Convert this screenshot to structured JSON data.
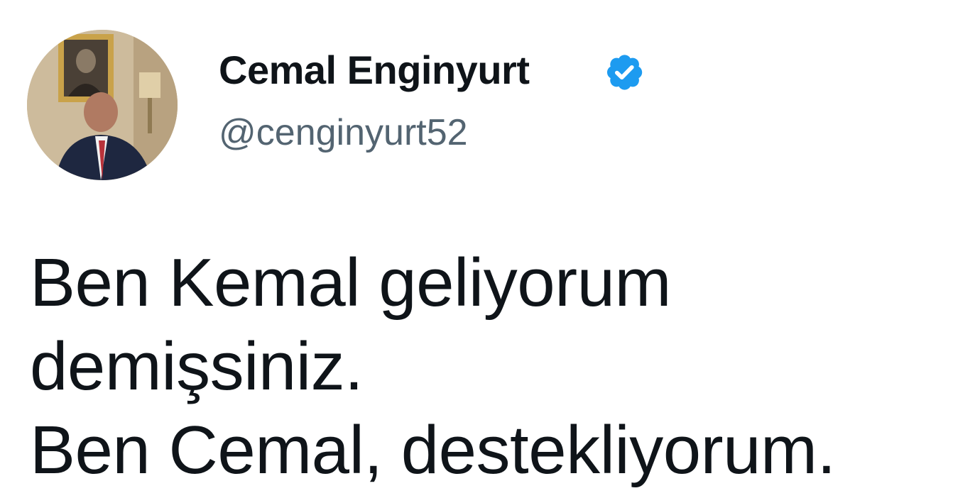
{
  "author": {
    "name": "Cemal Enginyurt",
    "handle": "@cenginyurt52",
    "verified": true,
    "verified_badge_color": "#1d9bf0"
  },
  "tweet": {
    "lines": [
      "Ben Kemal geliyorum",
      "demişsiniz.",
      "Ben Cemal, destekliyorum."
    ]
  },
  "colors": {
    "text_primary": "#0f1419",
    "text_secondary": "#536471",
    "background": "#ffffff"
  }
}
